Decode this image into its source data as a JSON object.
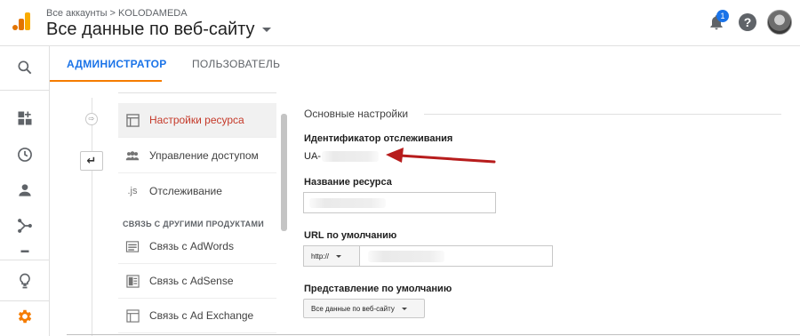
{
  "header": {
    "breadcrumb_account": "Все аккаунты",
    "breadcrumb_sep": ">",
    "breadcrumb_property": "KOLODAMEDA",
    "view_title": "Все данные по веб-сайту",
    "notification_count": "1",
    "help_label": "?"
  },
  "tabs": {
    "admin": "АДМИНИСТРАТОР",
    "user": "ПОЛЬЗОВАТЕЛЬ"
  },
  "nav": {
    "items": [
      {
        "label": "Настройки ресурса",
        "icon": "property-settings-icon"
      },
      {
        "label": "Управление доступом",
        "icon": "people-icon"
      },
      {
        "label": "Отслеживание",
        "icon": "js-icon"
      }
    ],
    "group_title": "СВЯЗЬ С ДРУГИМИ ПРОДУКТАМИ",
    "linked": [
      {
        "label": "Связь с AdWords",
        "icon": "adwords-icon"
      },
      {
        "label": "Связь с AdSense",
        "icon": "adsense-icon"
      },
      {
        "label": "Связь с Ad Exchange",
        "icon": "adexchange-icon"
      }
    ],
    "js_glyph": ".js"
  },
  "main": {
    "section_title": "Основные настройки",
    "tracking_id_label": "Идентификатор отслеживания",
    "tracking_id_value": "UA-",
    "property_name_label": "Название ресурса",
    "default_url_label": "URL по умолчанию",
    "protocol_value": "http://",
    "default_view_label": "Представление по умолчанию",
    "default_view_value": "Все данные по веб-сайту"
  },
  "colors": {
    "accent_blue": "#1a73e8",
    "active_tab_underline": "#f57c00",
    "active_nav_text": "#c53929",
    "annotation_arrow": "#b71c1c",
    "settings_gear": "#f57c00",
    "logo_orange": "#f9ab00"
  }
}
